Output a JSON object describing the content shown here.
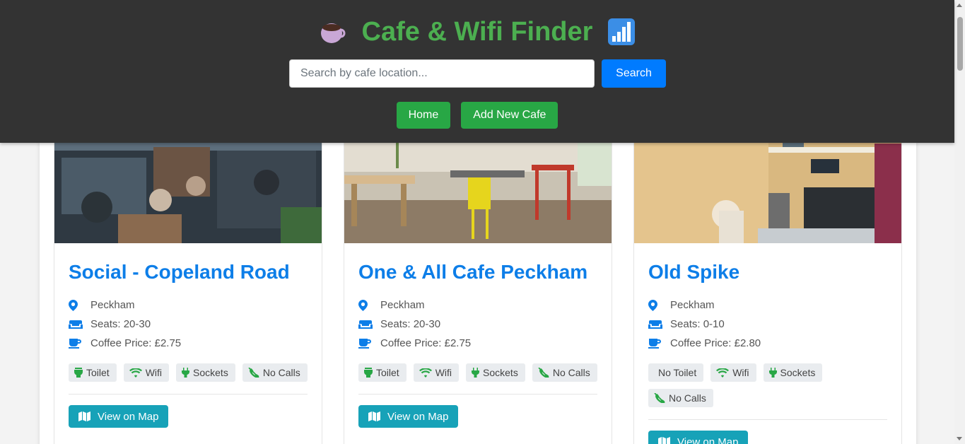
{
  "header": {
    "title": "Cafe & Wifi Finder",
    "left_emoji": "☕",
    "right_icon": "bar-chart-icon",
    "title_color": "#4caf50",
    "search": {
      "placeholder": "Search by cafe location...",
      "value": "",
      "button_label": "Search"
    },
    "nav": [
      {
        "label": "Home"
      },
      {
        "label": "Add New Cafe"
      }
    ]
  },
  "colors": {
    "header_bg": "#333333",
    "accent_green": "#28a745",
    "accent_blue": "#007bff",
    "title_blue": "#0d7ee8",
    "map_button": "#17a2b8",
    "tag_icon": "#28a745"
  },
  "cafes": [
    {
      "name": "Social - Copeland Road",
      "location": "Peckham",
      "seats": "Seats: 20-30",
      "price": "Coffee Price: £2.75",
      "amenities": [
        {
          "label": "Toilet",
          "icon": "toilet-icon"
        },
        {
          "label": "Wifi",
          "icon": "wifi-icon"
        },
        {
          "label": "Sockets",
          "icon": "plug-icon"
        },
        {
          "label": "No Calls",
          "icon": "phone-slash-icon"
        }
      ],
      "map_label": "View on Map"
    },
    {
      "name": "One & All Cafe Peckham",
      "location": "Peckham",
      "seats": "Seats: 20-30",
      "price": "Coffee Price: £2.75",
      "amenities": [
        {
          "label": "Toilet",
          "icon": "toilet-icon"
        },
        {
          "label": "Wifi",
          "icon": "wifi-icon"
        },
        {
          "label": "Sockets",
          "icon": "plug-icon"
        },
        {
          "label": "No Calls",
          "icon": "phone-slash-icon"
        }
      ],
      "map_label": "View on Map"
    },
    {
      "name": "Old Spike",
      "location": "Peckham",
      "seats": "Seats: 0-10",
      "price": "Coffee Price: £2.80",
      "amenities": [
        {
          "label": "No Toilet",
          "icon": "none"
        },
        {
          "label": "Wifi",
          "icon": "wifi-icon"
        },
        {
          "label": "Sockets",
          "icon": "plug-icon"
        },
        {
          "label": "No Calls",
          "icon": "phone-slash-icon"
        }
      ],
      "map_label": "View on Map"
    }
  ]
}
